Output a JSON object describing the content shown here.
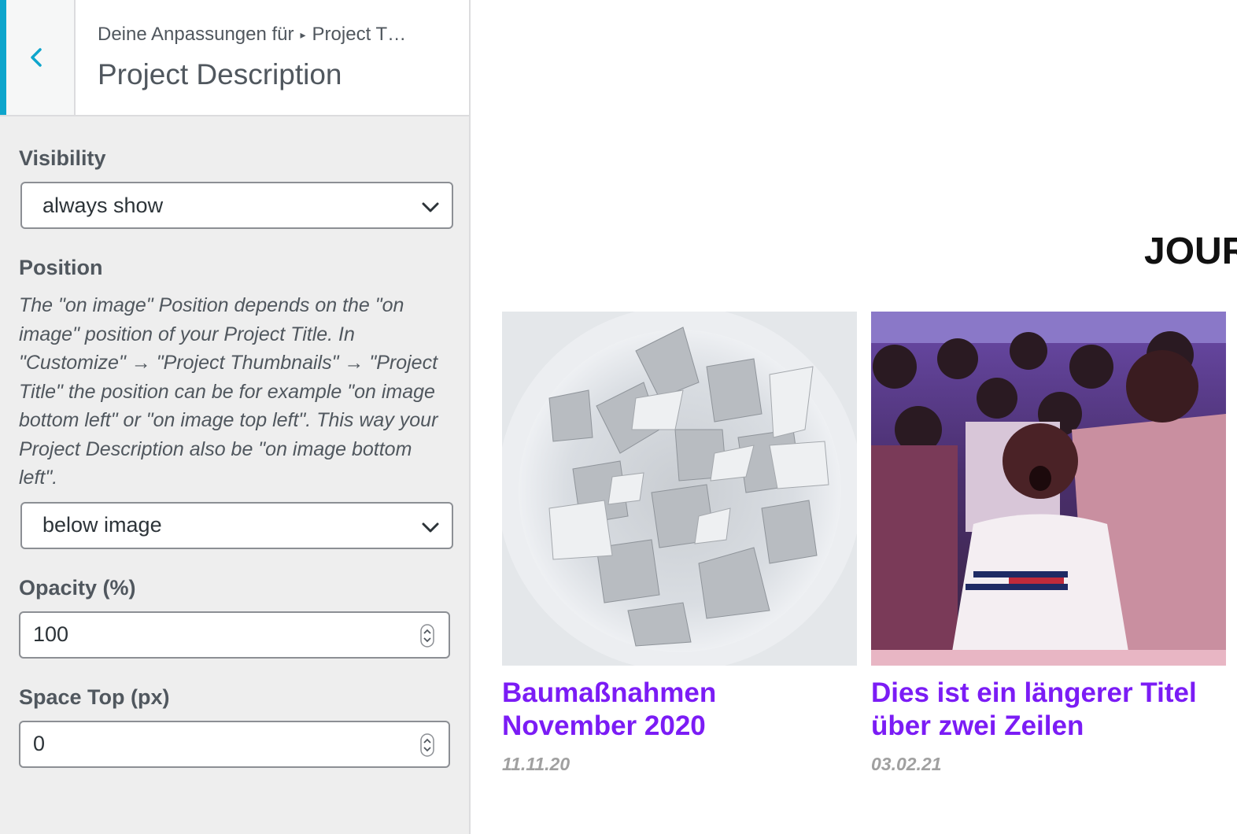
{
  "header": {
    "breadcrumb_prefix": "Deine Anpassungen für",
    "breadcrumb_parent": "Project T…",
    "title": "Project Description"
  },
  "controls": {
    "visibility": {
      "label": "Visibility",
      "value": "always show"
    },
    "position": {
      "label": "Position",
      "description": "The \"on image\" Position depends on the \"on image\" position of your Project Title. In \"Customize\" → \"Project Thumbnails\" → \"Project Title\" the position can be for example \"on image bottom left\" or \"on image top left\". This way your Project Description also be \"on image bottom left\".",
      "value": "below image"
    },
    "opacity": {
      "label": "Opacity (%)",
      "value": "100"
    },
    "space_top": {
      "label": "Space Top (px)",
      "value": "0"
    }
  },
  "preview": {
    "heading": "JOUR",
    "cards": [
      {
        "title": "Baumaßnahmen November 2020",
        "date": "11.11.20"
      },
      {
        "title": "Dies ist ein längerer Titel über zwei Zeilen",
        "date": "03.02.21"
      }
    ]
  },
  "colors": {
    "accent": "#0ea5cc",
    "link_title": "#7b1cf5",
    "date_text": "#a0a0a0"
  }
}
